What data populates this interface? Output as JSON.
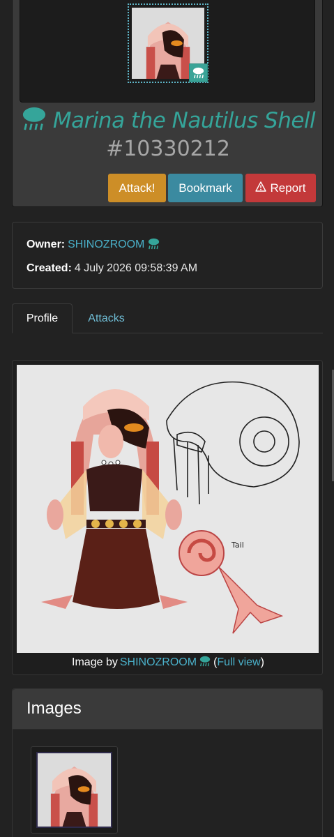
{
  "character": {
    "name": "Marina the Nautilus Shell",
    "id": "#10330212",
    "weather_icon": "rain-cloud-icon"
  },
  "actions": {
    "attack_label": "Attack!",
    "bookmark_label": "Bookmark",
    "report_label": "Report",
    "report_icon": "warning-triangle-icon"
  },
  "info": {
    "owner_label": "Owner:",
    "owner_name": "SHINOZROOM",
    "created_label": "Created:",
    "created_value": "4 July 2026 09:58:39 AM"
  },
  "tabs": [
    {
      "label": "Profile",
      "active": true
    },
    {
      "label": "Attacks",
      "active": false
    }
  ],
  "main_image": {
    "caption_prefix": "Image by",
    "artist": "SHINOZROOM",
    "open_paren": "(",
    "full_view_label": "Full view",
    "close_paren": ")",
    "art_text": "Tail"
  },
  "images_section": {
    "title": "Images"
  },
  "colors": {
    "accent_teal": "#35a59a",
    "link_blue": "#4ab0c9",
    "attack": "#cd8e27",
    "bookmark": "#3b8aa0",
    "report": "#c3393a"
  }
}
